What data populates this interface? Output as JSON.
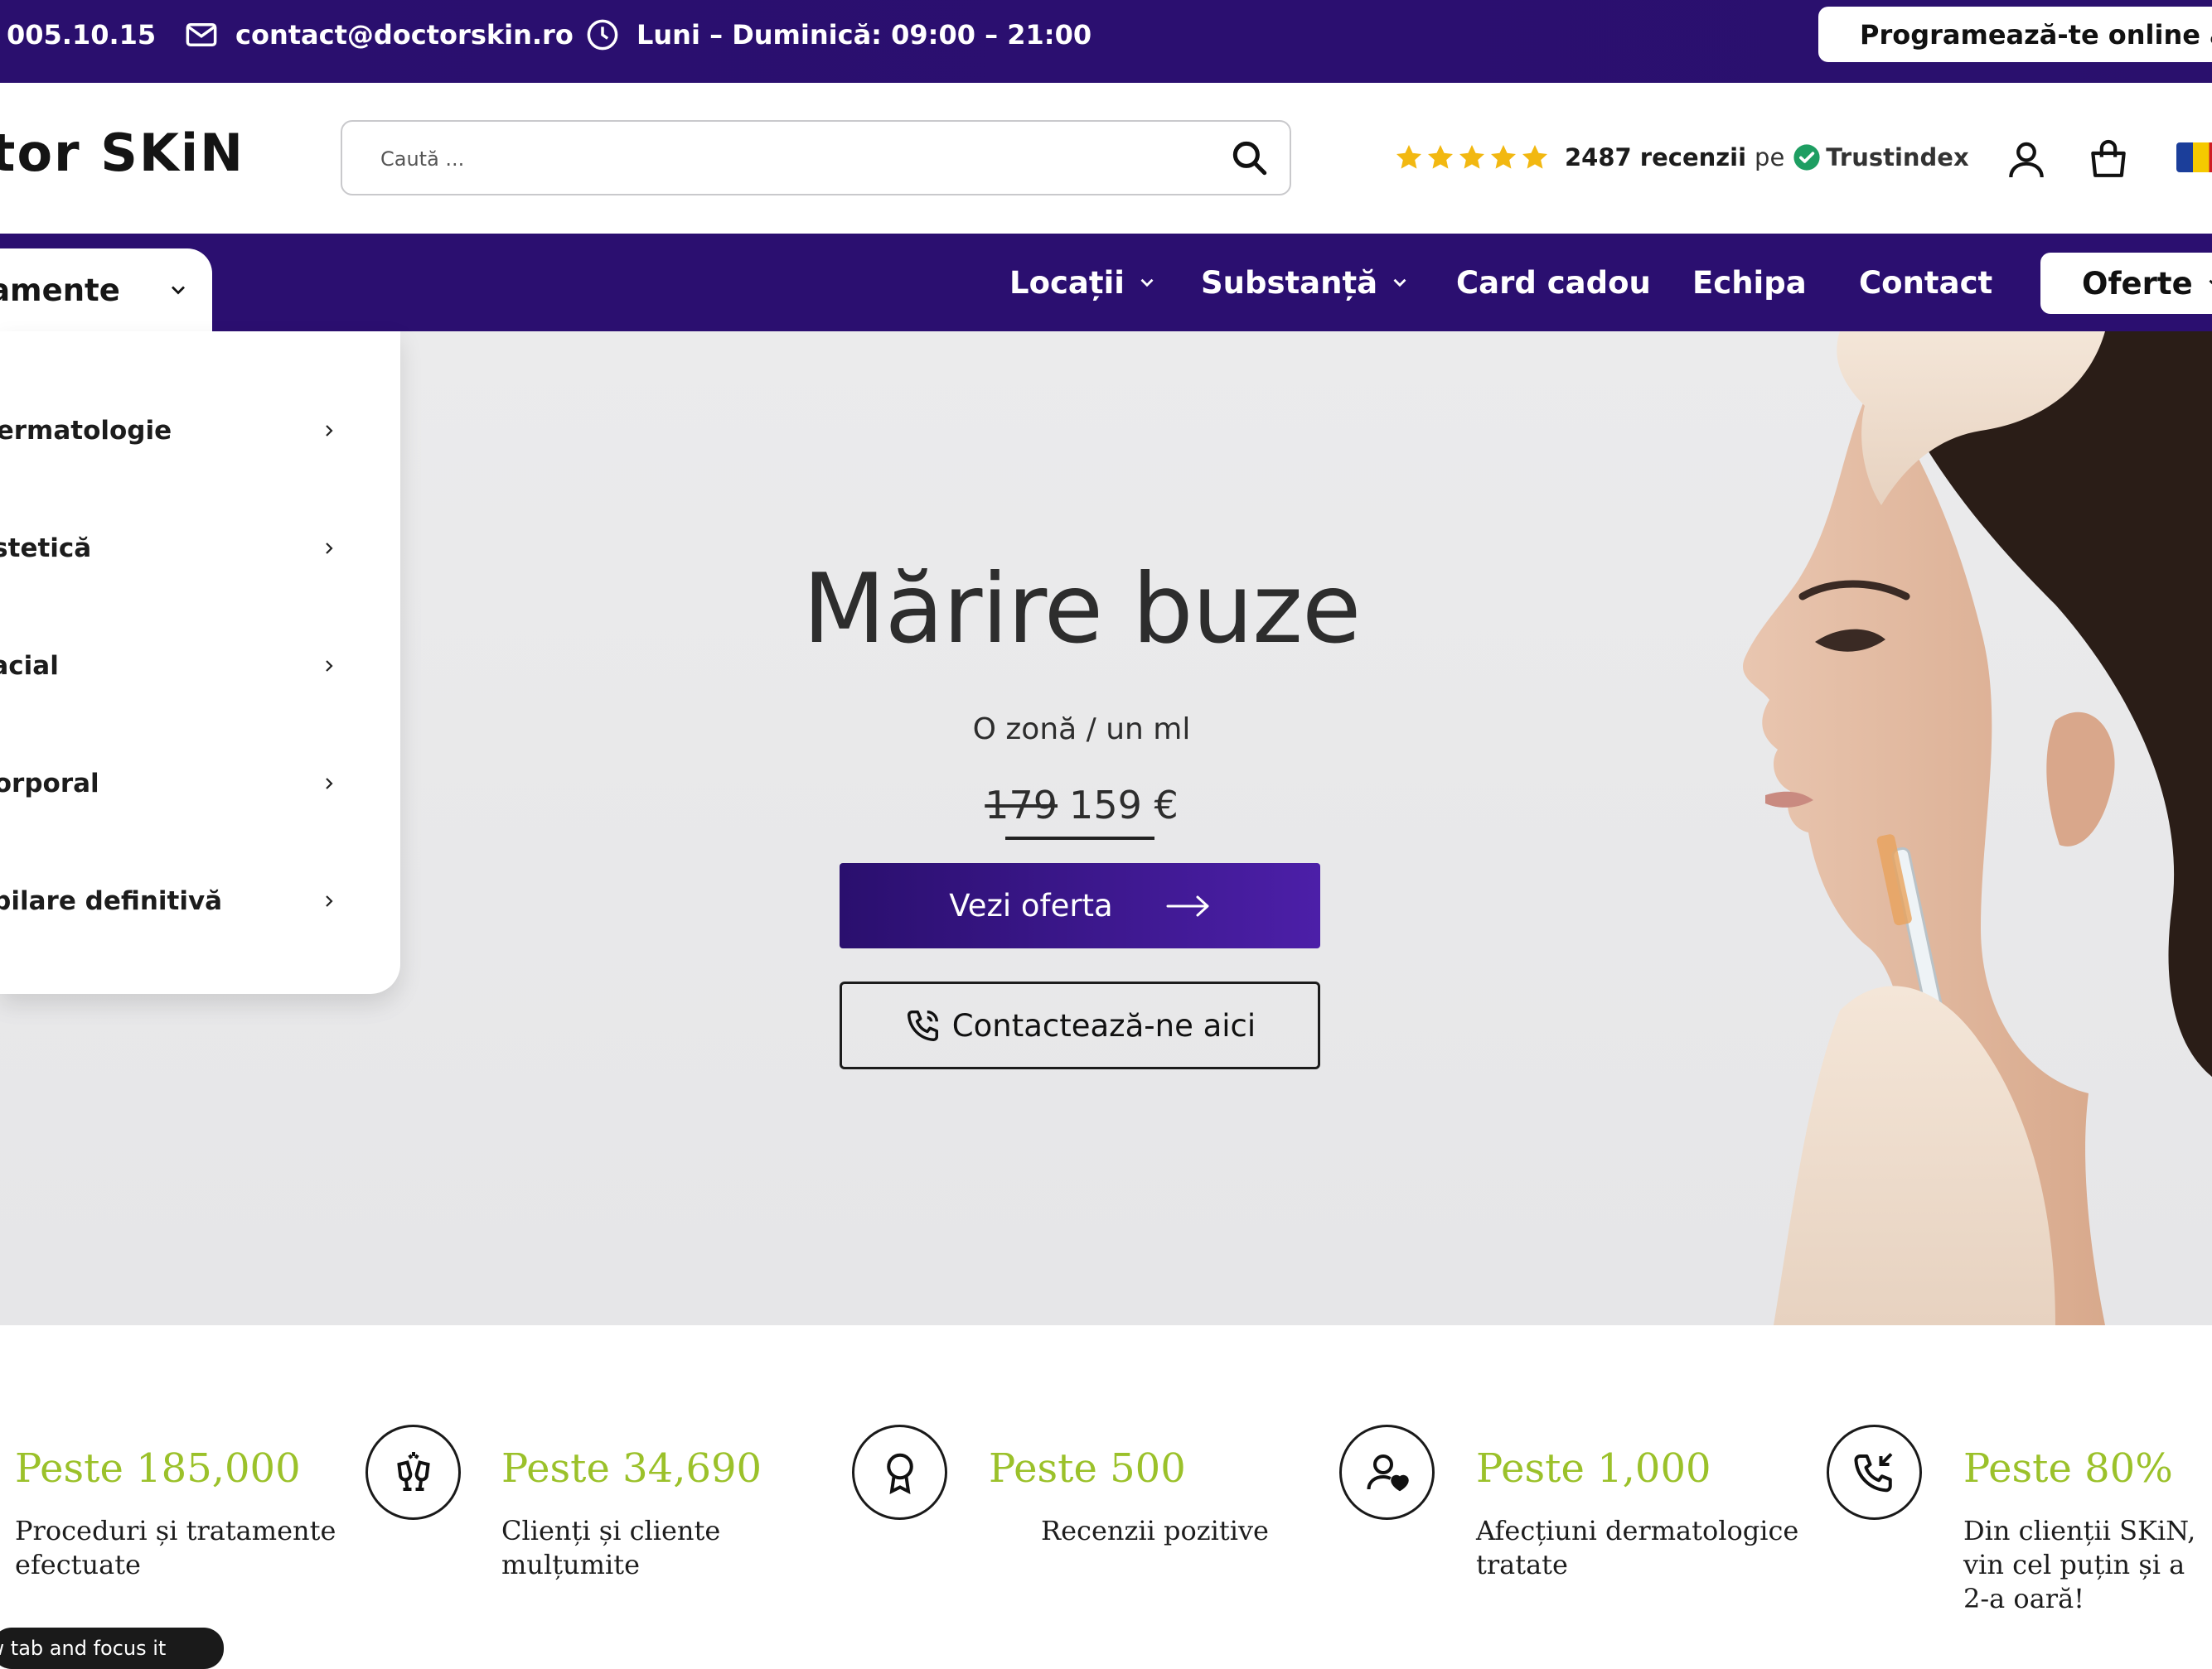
{
  "topbar": {
    "phone": "005.10.15",
    "email": "contact@doctorskin.ro",
    "hours": "Luni – Duminică: 09:00 – 21:00",
    "book_online": "Programează-te online aici"
  },
  "header": {
    "logo_text": "Doctor SKiN",
    "search_placeholder": "Caută ...",
    "rating_count": "2487 recenzii",
    "rating_on": "pe",
    "rating_provider": "Trustindex",
    "rating_stars": 5
  },
  "nav": {
    "treatments": "Tratamente",
    "locations": "Locații",
    "substance": "Substanță",
    "gift_card": "Card cadou",
    "team": "Echipa",
    "contact": "Contact",
    "offers": "Oferte"
  },
  "dropdown": {
    "items": [
      {
        "label": "Dermatologie"
      },
      {
        "label": "Estetică"
      },
      {
        "label": "Facial"
      },
      {
        "label": "Corporal"
      },
      {
        "label": "Epilare definitivă"
      }
    ]
  },
  "hero": {
    "title": "Mărire buze",
    "subtitle": "O zonă / un ml",
    "old_price": "179",
    "new_price": "159 €",
    "offer_button": "Vezi oferta",
    "contact_button": "Contactează-ne aici"
  },
  "stats": [
    {
      "number": "Peste 185,000",
      "desc": "Proceduri și tratamente efectuate"
    },
    {
      "number": "Peste 34,690",
      "desc": "Clienți și cliente mulțumite"
    },
    {
      "number": "Peste 500",
      "desc": "Recenzii pozitive"
    },
    {
      "number": "Peste 1,000",
      "desc": "Afecțiuni dermatologice tratate"
    },
    {
      "number": "Peste 80%",
      "desc": "Din clienții SKiN, vin cel puțin și a 2-a oară!"
    }
  ],
  "toast": "Open in a new tab and focus it",
  "colors": {
    "brand_purple": "#2b0f70",
    "accent_green": "#9bc12a",
    "star_gold": "#f2b811",
    "trust_green": "#1e9e62"
  }
}
